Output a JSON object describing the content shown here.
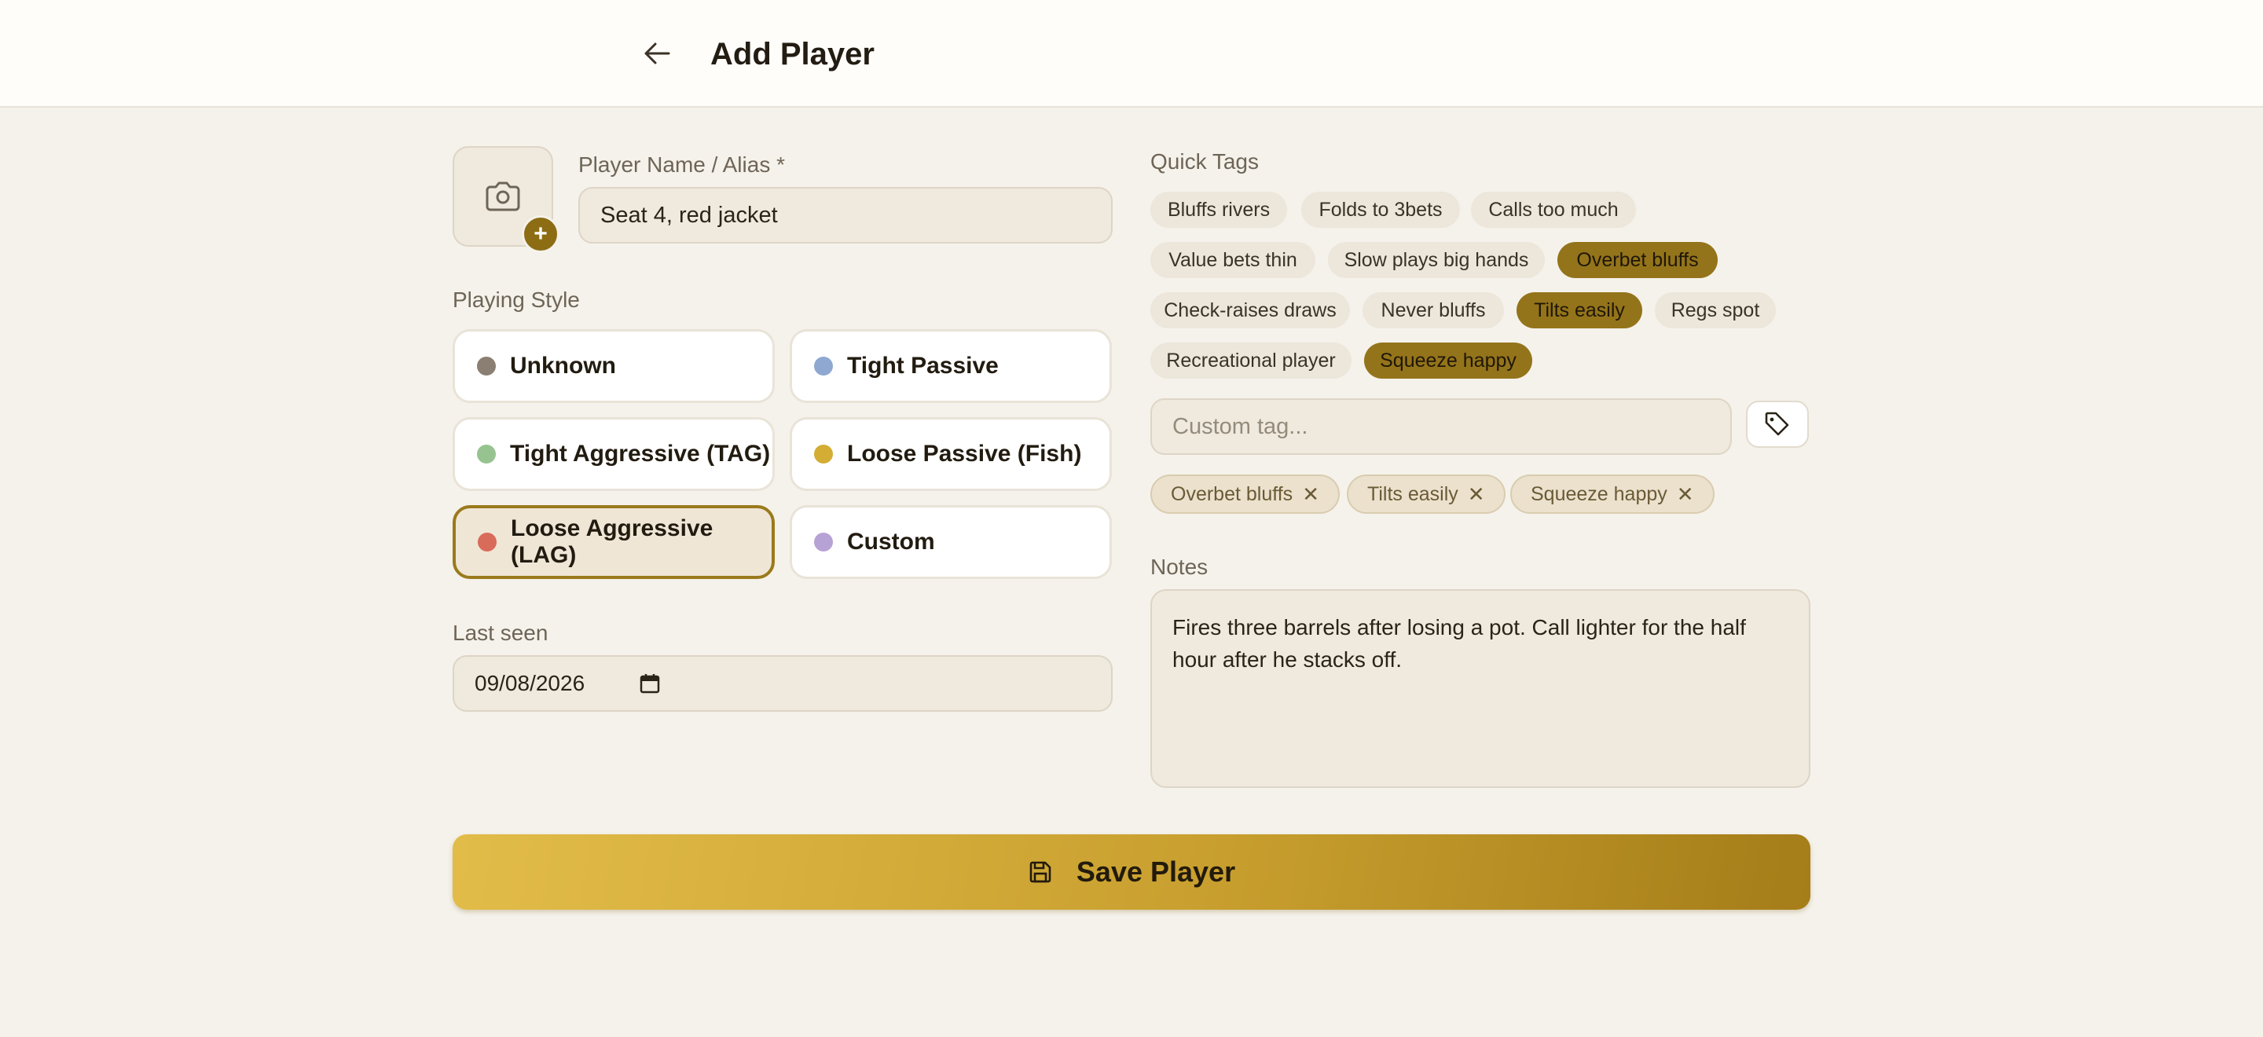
{
  "header": {
    "title": "Add Player"
  },
  "player_name": {
    "label": "Player Name / Alias *",
    "value": "Seat 4, red jacket"
  },
  "playing_style": {
    "label": "Playing Style",
    "options": [
      {
        "label": "Unknown",
        "color": "#8a7f72",
        "selected": false
      },
      {
        "label": "Tight Passive",
        "color": "#8fa8d2",
        "selected": false
      },
      {
        "label": "Tight Aggressive (TAG)",
        "color": "#97c390",
        "selected": false
      },
      {
        "label": "Loose Passive (Fish)",
        "color": "#d4ad34",
        "selected": false
      },
      {
        "label": "Loose Aggressive (LAG)",
        "color": "#d96b5b",
        "selected": true
      },
      {
        "label": "Custom",
        "color": "#b7a2d6",
        "selected": false
      }
    ]
  },
  "last_seen": {
    "label": "Last seen",
    "value": "09/08/2026"
  },
  "quick_tags": {
    "label": "Quick Tags",
    "tags": [
      {
        "label": "Bluffs rivers",
        "active": false
      },
      {
        "label": "Folds to 3bets",
        "active": false
      },
      {
        "label": "Calls too much",
        "active": false
      },
      {
        "label": "Value bets thin",
        "active": false
      },
      {
        "label": "Slow plays big hands",
        "active": false
      },
      {
        "label": "Overbet bluffs",
        "active": true
      },
      {
        "label": "Check-raises draws",
        "active": false
      },
      {
        "label": "Never bluffs",
        "active": false
      },
      {
        "label": "Tilts easily",
        "active": true
      },
      {
        "label": "Regs spot",
        "active": false
      },
      {
        "label": "Recreational player",
        "active": false
      },
      {
        "label": "Squeeze happy",
        "active": true
      }
    ]
  },
  "custom_tag": {
    "placeholder": "Custom tag..."
  },
  "selected_tags": [
    "Overbet bluffs",
    "Tilts easily",
    "Squeeze happy"
  ],
  "chip_remove_glyph": "✕",
  "notes": {
    "label": "Notes",
    "value": "Fires three barrels after losing a pot. Call lighter for the half hour after he stacks off."
  },
  "save_button": {
    "label": "Save Player"
  },
  "photo": {
    "add_glyph": "+"
  },
  "colors": {
    "accent": "#94741a",
    "background": "#f5f2eb"
  }
}
